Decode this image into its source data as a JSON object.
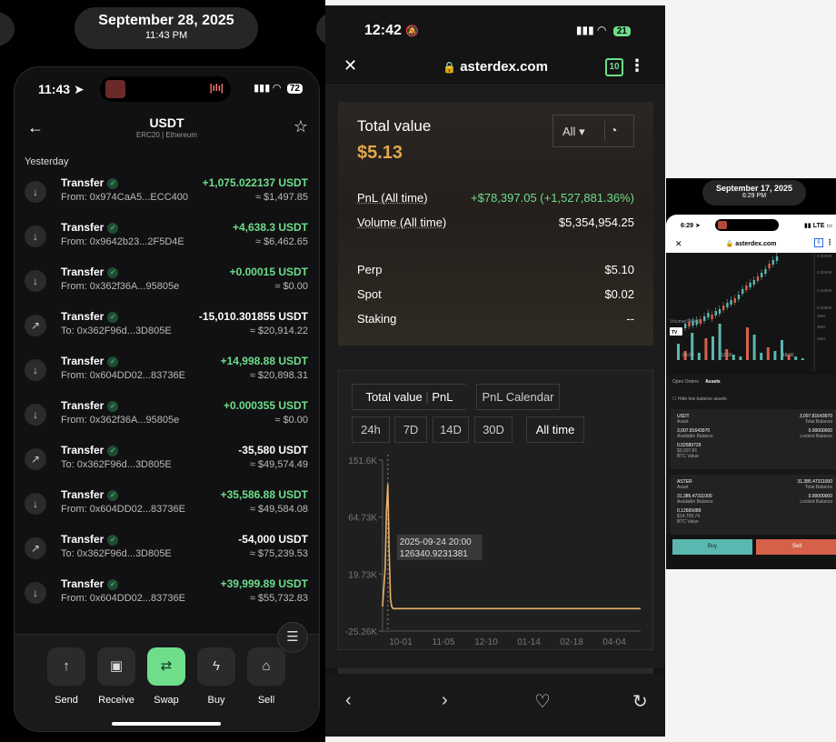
{
  "panel1": {
    "date_pill": {
      "date": "September 28, 2025",
      "time": "11:43 PM"
    },
    "status": {
      "time": "11:43",
      "battery": "72"
    },
    "header": {
      "title": "USDT",
      "subtitle": "ERC20 | Ethereum"
    },
    "section_label": "Yesterday",
    "transfers": [
      {
        "label": "Transfer",
        "dir": "in",
        "address": "From: 0x974CaA5...ECC400",
        "amount": "+1,075.022137 USDT",
        "usd": "≈ $1,497.85"
      },
      {
        "label": "Transfer",
        "dir": "in",
        "address": "From: 0x9642b23...2F5D4E",
        "amount": "+4,638.3 USDT",
        "usd": "≈ $6,462.65"
      },
      {
        "label": "Transfer",
        "dir": "in",
        "address": "From: 0x362f36A...95805e",
        "amount": "+0.00015 USDT",
        "usd": "≈ $0.00"
      },
      {
        "label": "Transfer",
        "dir": "out",
        "address": "To: 0x362F96d...3D805E",
        "amount": "-15,010.301855 USDT",
        "usd": "≈ $20,914.22"
      },
      {
        "label": "Transfer",
        "dir": "in",
        "address": "From: 0x604DD02...83736E",
        "amount": "+14,998.88 USDT",
        "usd": "≈ $20,898.31"
      },
      {
        "label": "Transfer",
        "dir": "in",
        "address": "From: 0x362f36A...95805e",
        "amount": "+0.000355 USDT",
        "usd": "≈ $0.00"
      },
      {
        "label": "Transfer",
        "dir": "out",
        "address": "To: 0x362F96d...3D805E",
        "amount": "-35,580 USDT",
        "usd": "≈ $49,574.49"
      },
      {
        "label": "Transfer",
        "dir": "in",
        "address": "From: 0x604DD02...83736E",
        "amount": "+35,586.88 USDT",
        "usd": "≈ $49,584.08"
      },
      {
        "label": "Transfer",
        "dir": "out",
        "address": "To: 0x362F96d...3D805E",
        "amount": "-54,000 USDT",
        "usd": "≈ $75,239.53"
      },
      {
        "label": "Transfer",
        "dir": "in",
        "address": "From: 0x604DD02...83736E",
        "amount": "+39,999.89 USDT",
        "usd": "≈ $55,732.83"
      }
    ],
    "actions": [
      "Send",
      "Receive",
      "Swap",
      "Buy",
      "Sell"
    ]
  },
  "panel2": {
    "status": {
      "time": "12:42",
      "battery": "21"
    },
    "url": "asterdex.com",
    "tab_count": "10",
    "total_value_label": "Total value",
    "total_value": "$5.13",
    "filter": "All",
    "pnl_label": "PnL (All time)",
    "pnl_value": "+$78,397.05 (+1,527,881.36%)",
    "volume_label": "Volume (All time)",
    "volume_value": "$5,354,954.25",
    "rows": [
      {
        "label": "Perp",
        "value": "$5.10"
      },
      {
        "label": "Spot",
        "value": "$0.02"
      },
      {
        "label": "Staking",
        "value": "--"
      }
    ],
    "tabs": [
      "Total value",
      "PnL",
      "PnL Calendar"
    ],
    "ranges": [
      "24h",
      "7D",
      "14D",
      "30D",
      "All time"
    ],
    "chart_data": {
      "type": "line",
      "x": [
        "2025-09-20",
        "2025-09-22",
        "2025-09-23",
        "2025-09-24",
        "2025-09-25",
        "2025-09-26",
        "2025-09-27",
        "2025-09-28",
        "2025-10-01",
        "2025-11-05",
        "2025-12-10",
        "2026-01-14",
        "2026-02-18",
        "2026-04-04"
      ],
      "values": [
        0,
        40000,
        100000,
        126340.92,
        60000,
        8000,
        0,
        -2000,
        -2000,
        -2000,
        -2000,
        -2000,
        -2000,
        -2000
      ],
      "y_ticks": [
        "151.6K",
        "64.73K",
        "19.73K",
        "-25.26K"
      ],
      "x_ticks": [
        "10-01",
        "11-05",
        "12-10",
        "01-14",
        "02-18",
        "04-04"
      ],
      "ylim": [
        -25260,
        151600
      ],
      "tooltip": {
        "date": "2025-09-24 20:00",
        "value": "126340.9231381"
      },
      "line_color": "#e8b26a"
    }
  },
  "panel3": {
    "date_pill": {
      "date": "September 17, 2025",
      "time": "6:29 PM"
    },
    "status": {
      "time": "6:29",
      "net": "LTE"
    },
    "url": "asterdex.com",
    "tab_count": "6",
    "volume_label": "Volume SMA 9",
    "right_ticks": [
      "0.30000",
      "0.20000",
      "0.10000",
      "0.00000",
      "35M",
      "30M",
      "25M"
    ],
    "x_ticks": [
      "06:00",
      "12:00",
      "18:00"
    ],
    "tabs": {
      "open_orders": "Open Orders",
      "assets": "Assets"
    },
    "hide_label": "Hide low balance assets",
    "assets": [
      {
        "name": "USDT",
        "sub": "Asset",
        "total": "3,007.81643970",
        "total_label": "Total Balance",
        "avail": "3,007.81643970",
        "avail_label": "Available Balance",
        "locked": "0.00000000",
        "locked_label": "Locked Balance",
        "btc": "0.02589729",
        "usd": "$3,007.81",
        "btc_label": "BTC Value"
      },
      {
        "name": "ASTER",
        "sub": "Asset",
        "total": "31,385.47311000",
        "total_label": "Total Balance",
        "avail": "31,385.47311000",
        "avail_label": "Available Balance",
        "locked": "0.00000000",
        "locked_label": "Locked Balance",
        "btc": "0.12665089",
        "usd": "$14,709.74",
        "btc_label": "BTC Value"
      }
    ],
    "buy": "Buy",
    "sell": "Sell"
  }
}
